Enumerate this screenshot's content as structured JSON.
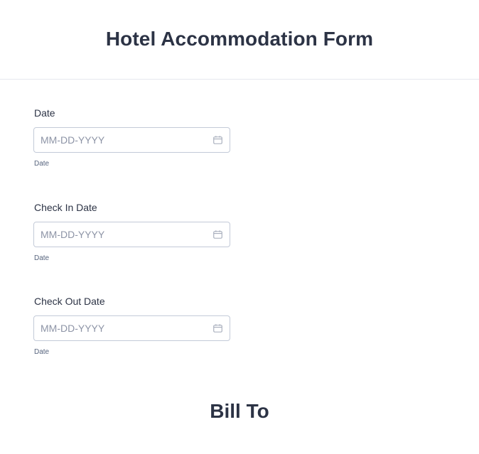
{
  "form": {
    "title": "Hotel Accommodation Form"
  },
  "fields": [
    {
      "label": "Date",
      "placeholder": "MM-DD-YYYY",
      "sublabel": "Date",
      "icon": "calendar-icon"
    },
    {
      "label": "Check In Date",
      "placeholder": "MM-DD-YYYY",
      "sublabel": "Date",
      "icon": "calendar-icon"
    },
    {
      "label": "Check Out Date",
      "placeholder": "MM-DD-YYYY",
      "sublabel": "Date",
      "icon": "calendar-icon"
    }
  ],
  "section": {
    "title": "Bill To"
  },
  "colors": {
    "text": "#2c3345",
    "placeholder": "#8d94a6",
    "border": "#c3cad8",
    "divider": "#e6e8ee",
    "sublabel": "#57647e"
  }
}
